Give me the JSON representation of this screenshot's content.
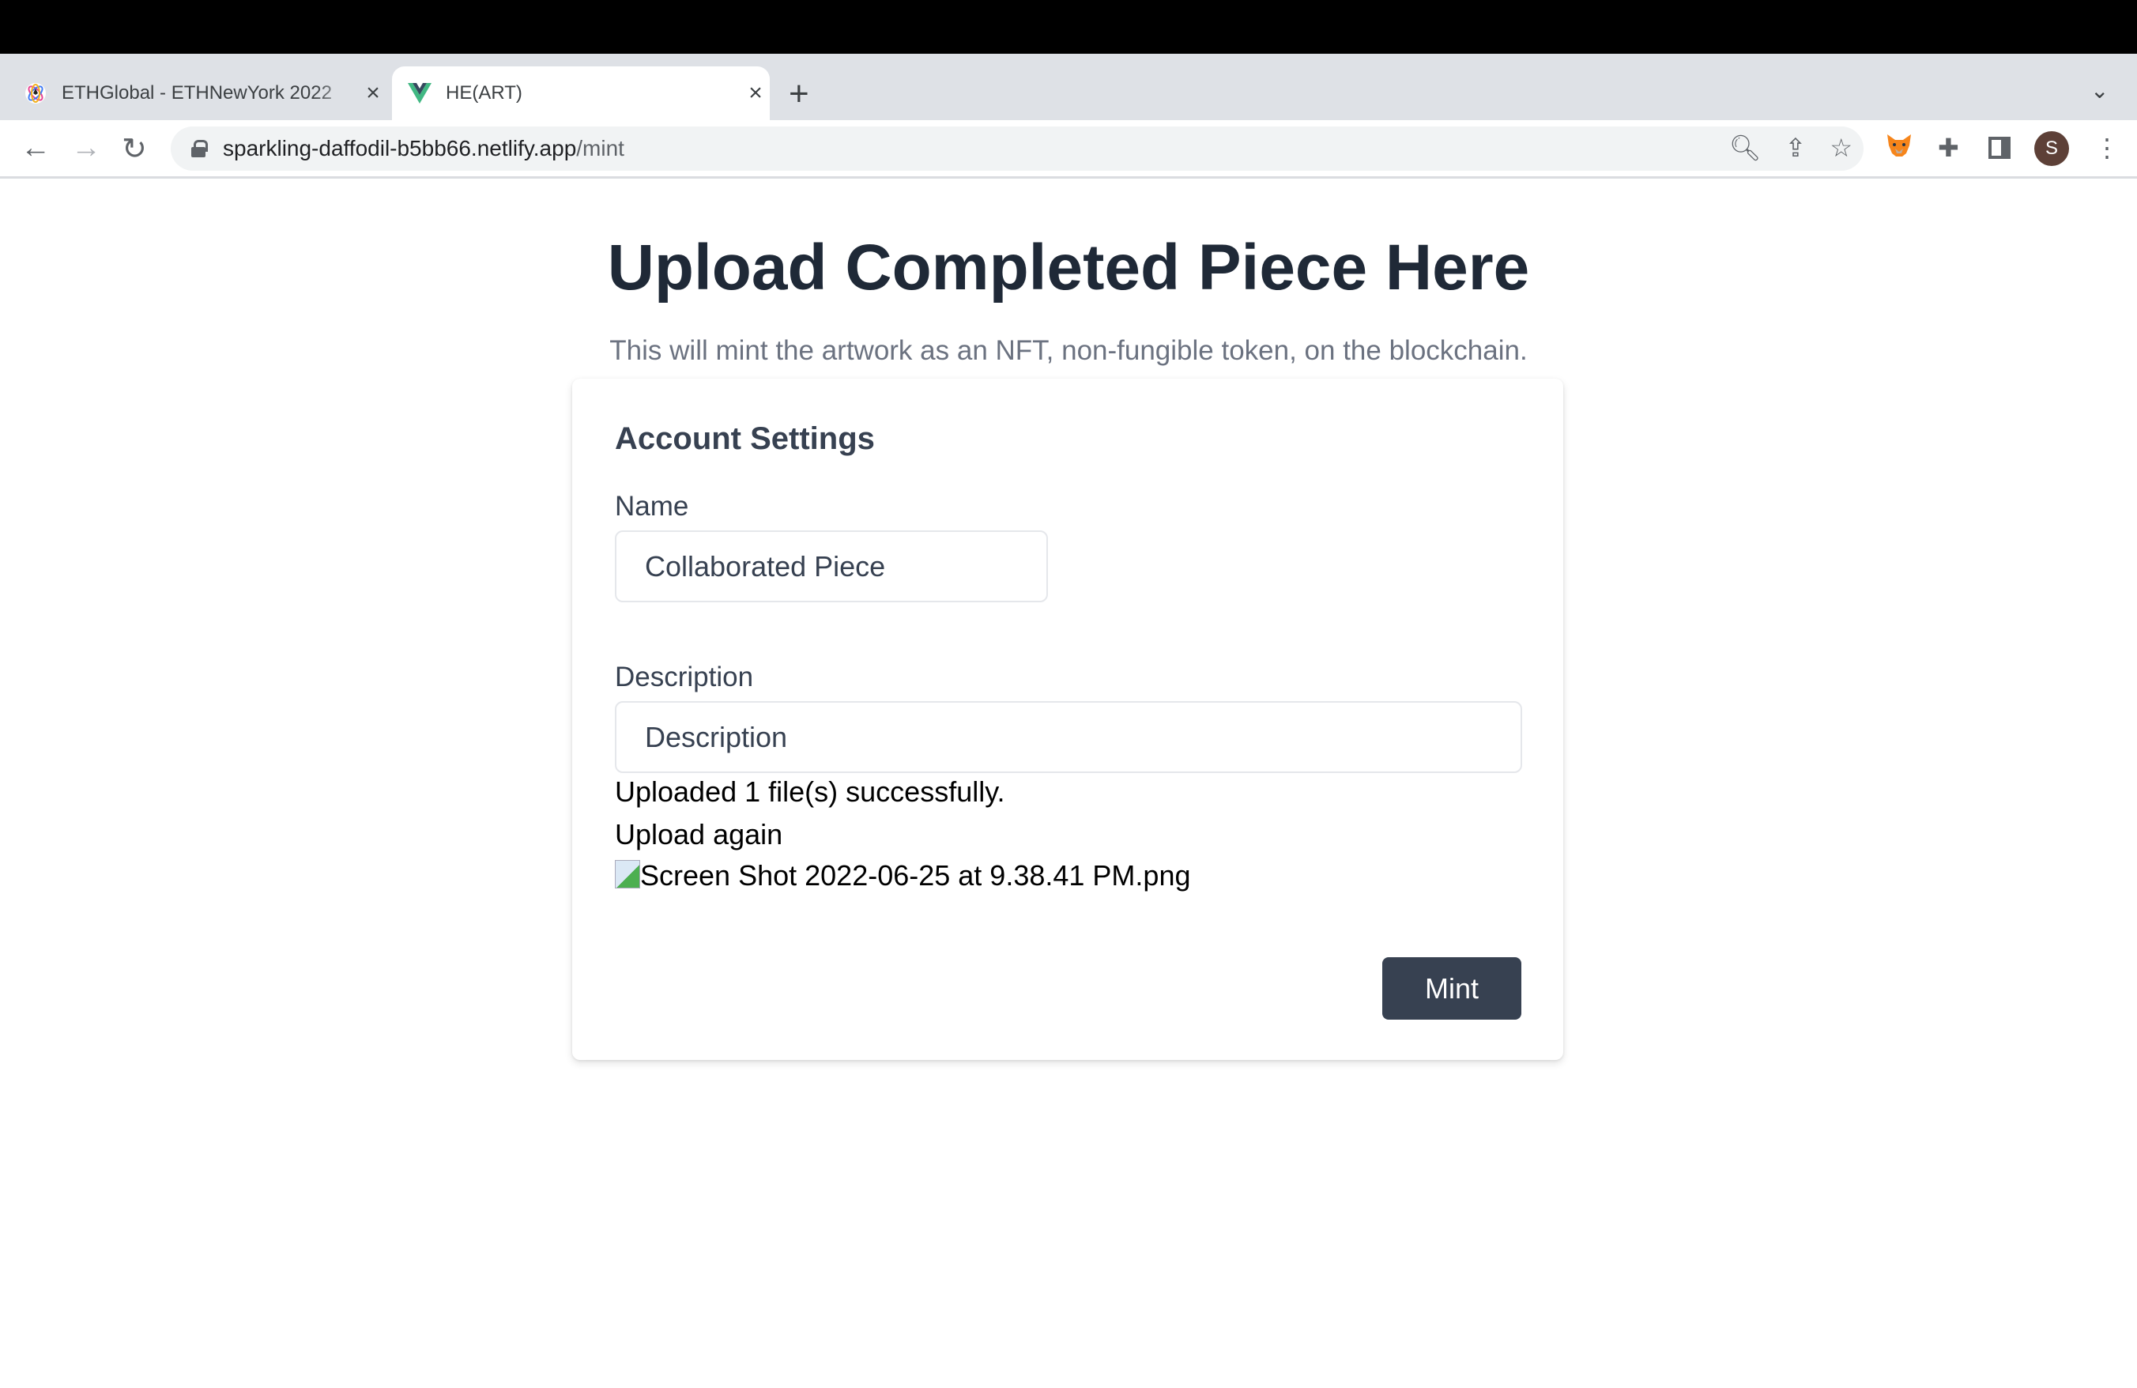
{
  "browser": {
    "tabs": [
      {
        "title": "ETHGlobal - ETHNewYork 2022",
        "icon": "ethglobal-favicon",
        "active": false
      },
      {
        "title": "HE(ART)",
        "icon": "vue-favicon",
        "active": true
      }
    ],
    "url_host": "sparkling-daffodil-b5bb66.netlify.app",
    "url_path": "/mint",
    "profile_initial": "S"
  },
  "page": {
    "title": "Upload Completed Piece Here",
    "subtitle": "This will mint the artwork as an NFT, non-fungible token, on the blockchain."
  },
  "form": {
    "heading": "Account Settings",
    "name_label": "Name",
    "name_value": "Collaborated Piece",
    "description_label": "Description",
    "description_placeholder": "Description",
    "upload_status": "Uploaded 1 file(s) successfully.",
    "upload_again": "Upload again",
    "image_alt": "Screen Shot 2022-06-25 at 9.38.41 PM.png",
    "mint_label": "Mint"
  },
  "colors": {
    "button": "#374151",
    "heading": "#1f2937",
    "subtitle": "#6b7280",
    "avatar": "#5d4037"
  }
}
